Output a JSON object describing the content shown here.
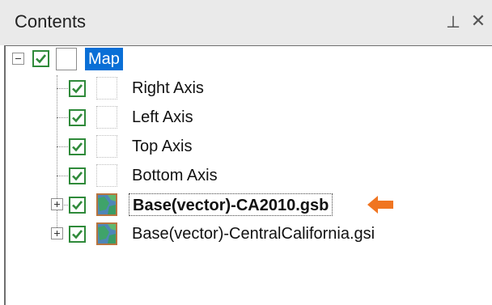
{
  "panel": {
    "title": "Contents",
    "pin_icon": "pin-icon",
    "close_icon": "close-icon"
  },
  "tree": {
    "root": {
      "label": "Map",
      "checked": true,
      "expanded": true,
      "selected": true,
      "icon": "map-frame-icon"
    },
    "children": [
      {
        "label": "Right Axis",
        "checked": true,
        "icon": "axis-icon"
      },
      {
        "label": "Left Axis",
        "checked": true,
        "icon": "axis-icon"
      },
      {
        "label": "Top Axis",
        "checked": true,
        "icon": "axis-icon"
      },
      {
        "label": "Bottom Axis",
        "checked": true,
        "icon": "axis-icon"
      },
      {
        "label": "Base(vector)-CA2010.gsb",
        "checked": true,
        "icon": "base-map-icon",
        "expandable": true,
        "bold": true,
        "focused": true
      },
      {
        "label": "Base(vector)-CentralCalifornia.gsi",
        "checked": true,
        "icon": "base-map-icon",
        "expandable": true
      }
    ]
  },
  "colors": {
    "selection": "#0a6fd6",
    "checkbox_border": "#2f8a3a",
    "arrow": "#f07521"
  }
}
